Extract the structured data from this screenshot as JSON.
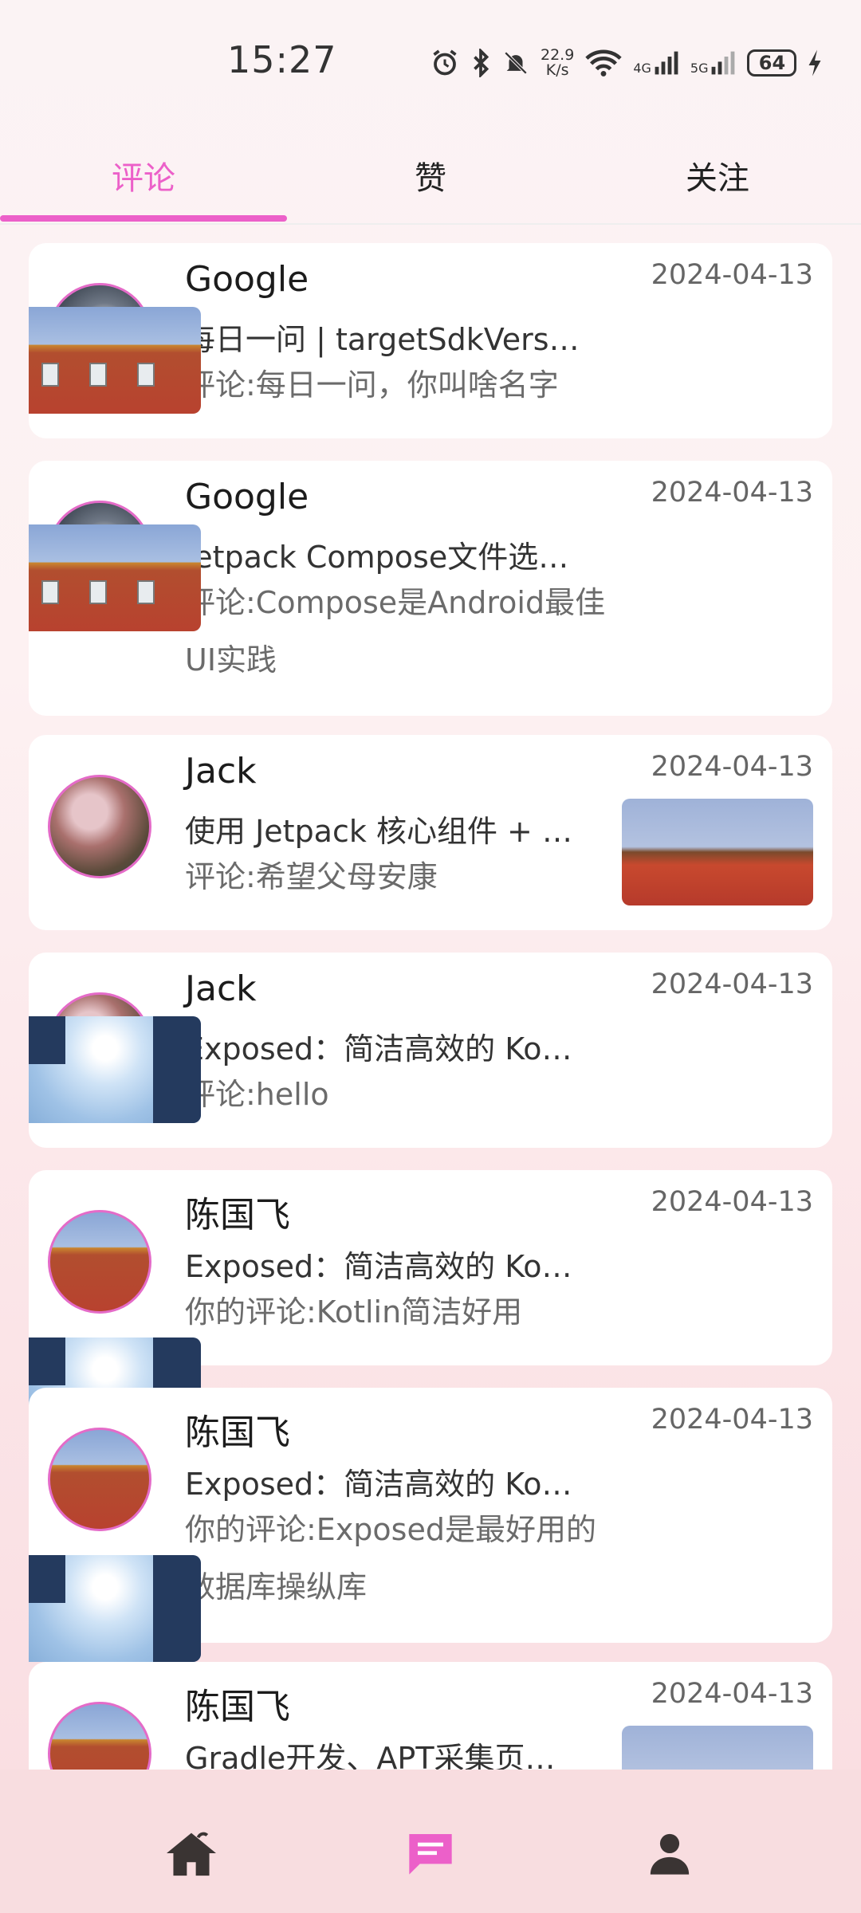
{
  "status_bar": {
    "time": "15:27",
    "speed_value": "22.9",
    "speed_unit": "K/s",
    "net1": "4G",
    "net2": "5G",
    "battery": "64",
    "icons": [
      "alarm-icon",
      "bluetooth-icon",
      "mute-icon",
      "wifi-icon",
      "signal-icon",
      "signal-icon",
      "battery-icon",
      "charging-icon"
    ]
  },
  "tabs": [
    {
      "label": "评论",
      "active": true
    },
    {
      "label": "赞",
      "active": false
    },
    {
      "label": "关注",
      "active": false
    }
  ],
  "items": [
    {
      "name": "Google",
      "date": "2024-04-13",
      "title": "每日一问 | targetSdkVers…",
      "comment": "评论:每日一问，你叫啥名字",
      "avatar": "moon",
      "thumb": "wall"
    },
    {
      "name": "Google",
      "date": "2024-04-13",
      "title": "Jetpack Compose文件选…",
      "comment": "评论:Compose是Android最佳UI实践",
      "avatar": "moon",
      "thumb": "wall"
    },
    {
      "name": "Jack",
      "date": "2024-04-13",
      "title": "使用 Jetpack 核心组件 + …",
      "comment": "评论:希望父母安康",
      "avatar": "blossom",
      "thumb": "palace"
    },
    {
      "name": "Jack",
      "date": "2024-04-13",
      "title": "Exposed：简洁高效的 Ko…",
      "comment": "评论:hello",
      "avatar": "blossom",
      "thumb": "sky"
    },
    {
      "name": "陈国飞",
      "date": "2024-04-13",
      "title": "Exposed：简洁高效的 Ko…",
      "comment": "你的评论:Kotlin简洁好用",
      "avatar": "wall",
      "thumb": "sky"
    },
    {
      "name": "陈国飞",
      "date": "2024-04-13",
      "title": "Exposed：简洁高效的 Ko…",
      "comment": "你的评论:Exposed是最好用的数据库操纵库",
      "avatar": "wall",
      "thumb": "sky"
    },
    {
      "name": "陈国飞",
      "date": "2024-04-13",
      "title": "Gradle开发、APT采集页…",
      "comment": "",
      "avatar": "wall",
      "thumb": "palace"
    }
  ],
  "bottom_nav": [
    {
      "icon": "home-icon",
      "active": false
    },
    {
      "icon": "message-icon",
      "active": true
    },
    {
      "icon": "person-icon",
      "active": false
    }
  ],
  "colors": {
    "accent": "#ec60c9",
    "text": "#222222",
    "muted": "#6b6b6b",
    "card": "#ffffff"
  }
}
